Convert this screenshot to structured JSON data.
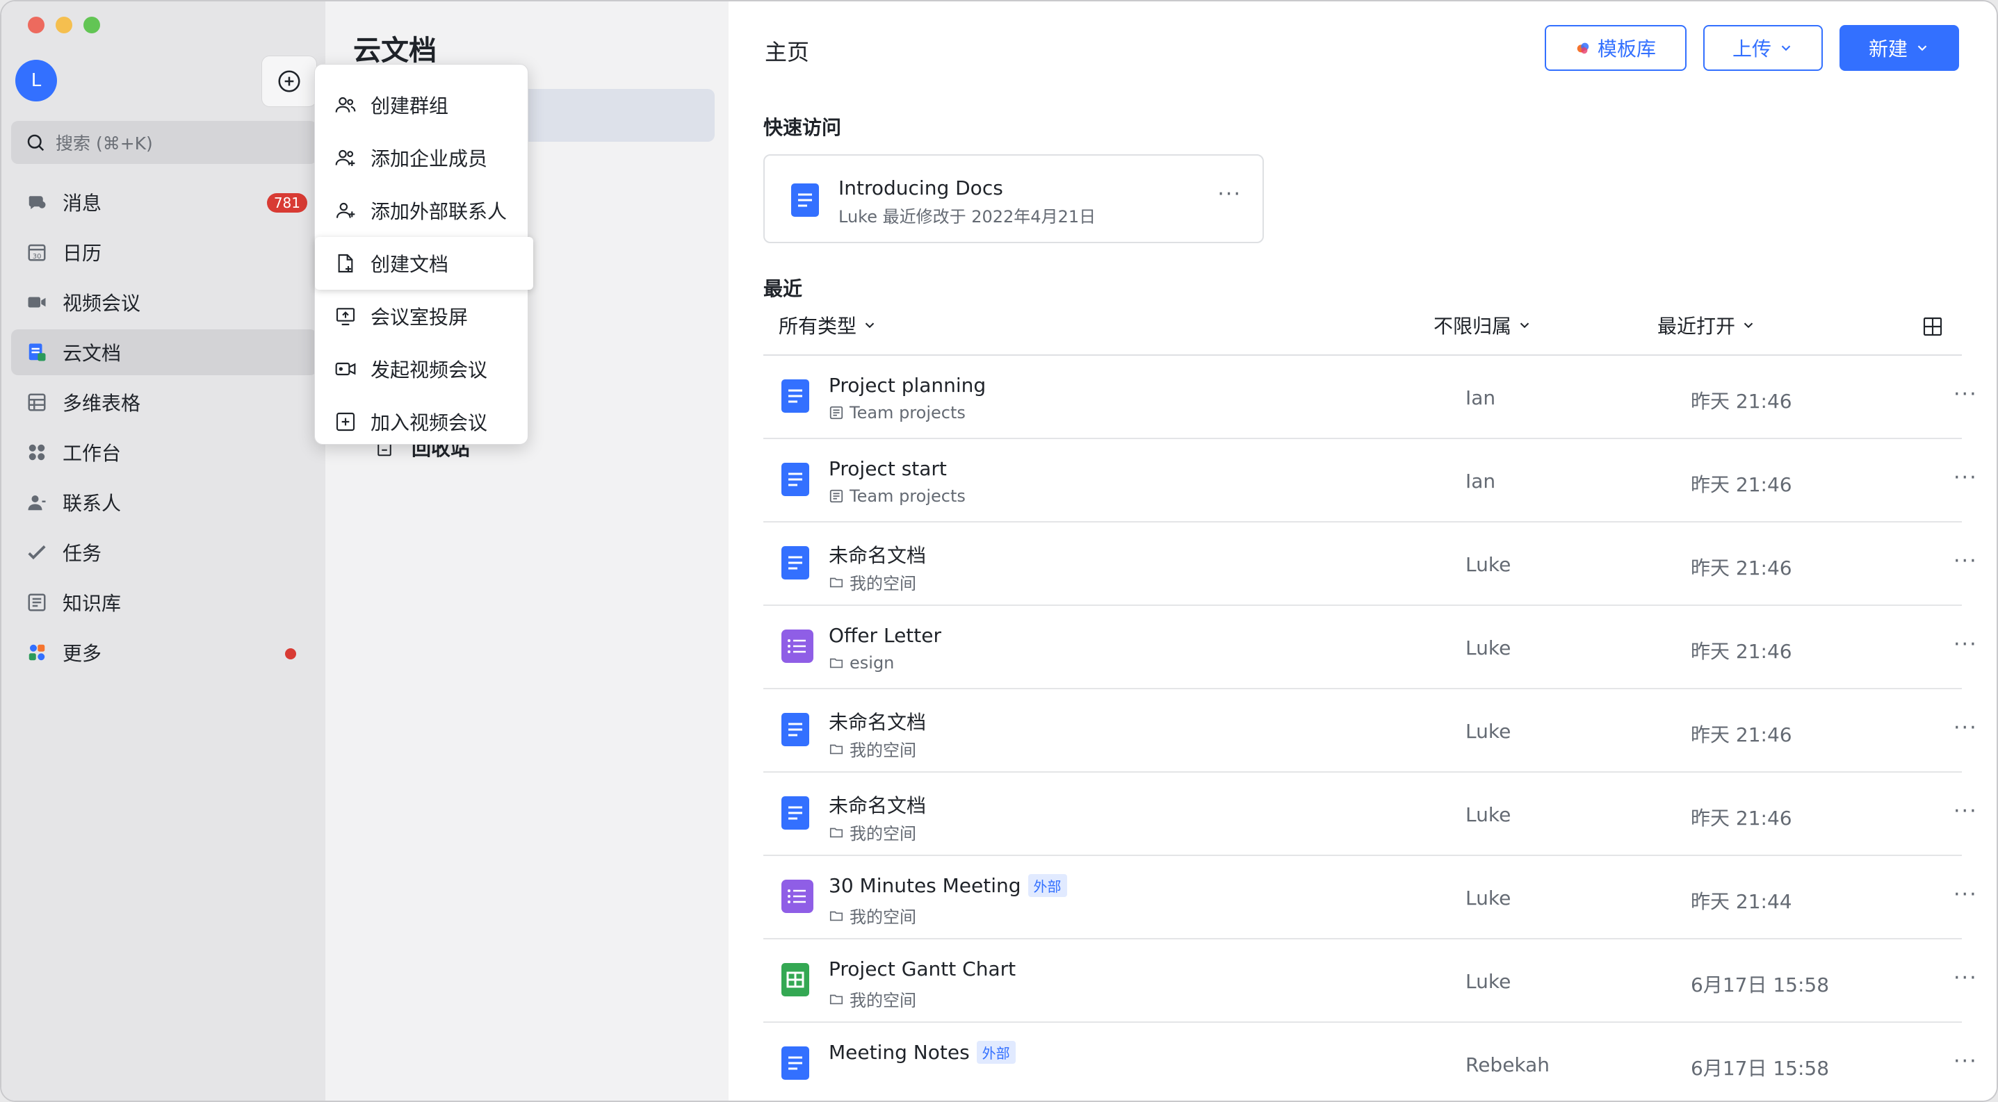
{
  "sidebar": {
    "avatar_letter": "L",
    "search_placeholder": "搜索 (⌘+K)",
    "items": [
      {
        "label": "消息",
        "icon": "chat-icon",
        "badge": "781"
      },
      {
        "label": "日历",
        "icon": "calendar-icon"
      },
      {
        "label": "视频会议",
        "icon": "video-icon"
      },
      {
        "label": "云文档",
        "icon": "docs-icon",
        "active": true
      },
      {
        "label": "多维表格",
        "icon": "base-icon"
      },
      {
        "label": "工作台",
        "icon": "workplace-icon"
      },
      {
        "label": "联系人",
        "icon": "contacts-icon"
      },
      {
        "label": "任务",
        "icon": "tasks-icon"
      },
      {
        "label": "知识库",
        "icon": "wiki-icon"
      },
      {
        "label": "更多",
        "icon": "more-apps-icon",
        "dot": true
      }
    ]
  },
  "middle": {
    "title": "云文档",
    "trash_label": "回收站"
  },
  "menu": {
    "items": [
      {
        "label": "创建群组",
        "icon": "group-icon"
      },
      {
        "label": "添加企业成员",
        "icon": "add-member-icon"
      },
      {
        "label": "添加外部联系人",
        "icon": "add-contact-icon"
      },
      {
        "label": "创建文档",
        "icon": "new-doc-icon",
        "hover": true
      },
      {
        "label": "会议室投屏",
        "icon": "screen-share-icon"
      },
      {
        "label": "发起视频会议",
        "icon": "start-video-icon"
      },
      {
        "label": "加入视频会议",
        "icon": "join-video-icon"
      }
    ]
  },
  "main": {
    "title": "主页",
    "buttons": {
      "template": "模板库",
      "upload": "上传",
      "new": "新建"
    },
    "quick_access_label": "快速访问",
    "quick_card": {
      "title": "Introducing Docs",
      "subtitle": "Luke 最近修改于 2022年4月21日"
    },
    "recent_label": "最近",
    "filters": {
      "type": "所有类型",
      "owner": "不限归属",
      "sort": "最近打开"
    },
    "rows": [
      {
        "name": "Project planning",
        "location": "Team projects",
        "loc_icon": "wiki-icon",
        "owner": "Ian",
        "time": "昨天 21:46",
        "icon": "doc",
        "tag": ""
      },
      {
        "name": "Project start",
        "location": "Team projects",
        "loc_icon": "wiki-icon",
        "owner": "Ian",
        "time": "昨天 21:46",
        "icon": "doc",
        "tag": ""
      },
      {
        "name": "未命名文档",
        "location": "我的空间",
        "loc_icon": "folder-icon",
        "owner": "Luke",
        "time": "昨天 21:46",
        "icon": "doc",
        "tag": ""
      },
      {
        "name": "Offer Letter",
        "location": "esign",
        "loc_icon": "folder-icon",
        "owner": "Luke",
        "time": "昨天 21:46",
        "icon": "form",
        "tag": ""
      },
      {
        "name": "未命名文档",
        "location": "我的空间",
        "loc_icon": "folder-icon",
        "owner": "Luke",
        "time": "昨天 21:46",
        "icon": "doc",
        "tag": ""
      },
      {
        "name": "未命名文档",
        "location": "我的空间",
        "loc_icon": "folder-icon",
        "owner": "Luke",
        "time": "昨天 21:46",
        "icon": "doc",
        "tag": ""
      },
      {
        "name": "30 Minutes Meeting",
        "location": "我的空间",
        "loc_icon": "folder-icon",
        "owner": "Luke",
        "time": "昨天 21:44",
        "icon": "form",
        "tag": "外部"
      },
      {
        "name": "Project Gantt Chart",
        "location": "我的空间",
        "loc_icon": "folder-icon",
        "owner": "Luke",
        "time": "6月17日 15:58",
        "icon": "sheet",
        "tag": ""
      },
      {
        "name": "Meeting Notes",
        "location": "",
        "loc_icon": "",
        "owner": "Rebekah",
        "time": "6月17日 15:58",
        "icon": "doc",
        "tag": "外部"
      }
    ]
  },
  "colors": {
    "accent": "#3370ff",
    "badge": "#d83b34",
    "doc": "#3370ff",
    "form": "#8f5ee6",
    "sheet": "#34a853"
  }
}
